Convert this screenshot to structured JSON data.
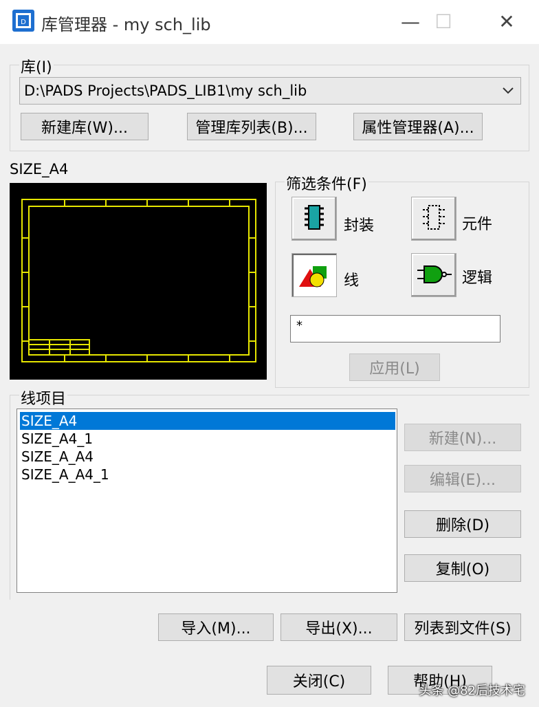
{
  "window": {
    "title": "库管理器 - my sch_lib",
    "minimize": "—",
    "maximize": "☐",
    "close": "✕"
  },
  "library": {
    "group_label": "库(I)",
    "path_value": "D:\\PADS Projects\\PADS_LIB1\\my sch_lib",
    "dropdown_icon": "chevron-down-icon",
    "new_lib_button": "新建库(W)...",
    "manage_list_button": "管理库列表(B)...",
    "attr_manager_button": "属性管理器(A)..."
  },
  "preview": {
    "name": "SIZE_A4"
  },
  "filter": {
    "group_label": "筛选条件(F)",
    "decal_label": "封装",
    "part_label": "元件",
    "lines_label": "线",
    "logic_label": "逻辑",
    "filter_text": "*",
    "apply_button": "应用(L)",
    "active": "lines"
  },
  "items": {
    "group_label": "线项目",
    "list": [
      "SIZE_A4",
      "SIZE_A4_1",
      "SIZE_A_A4",
      "SIZE_A_A4_1"
    ],
    "selected_index": 0,
    "new_button": "新建(N)...",
    "edit_button": "编辑(E)...",
    "delete_button": "删除(D)",
    "copy_button": "复制(O)"
  },
  "bottom": {
    "import_button": "导入(M)...",
    "export_button": "导出(X)...",
    "list_to_file_button": "列表到文件(S)",
    "close_button": "关闭(C)",
    "help_button": "帮助(H)"
  },
  "watermark": "头条 @82后技术宅",
  "colors": {
    "selection": "#0078d7",
    "title_border_yellow": "#e6e600",
    "accent_blue": "#1e6fd0"
  }
}
